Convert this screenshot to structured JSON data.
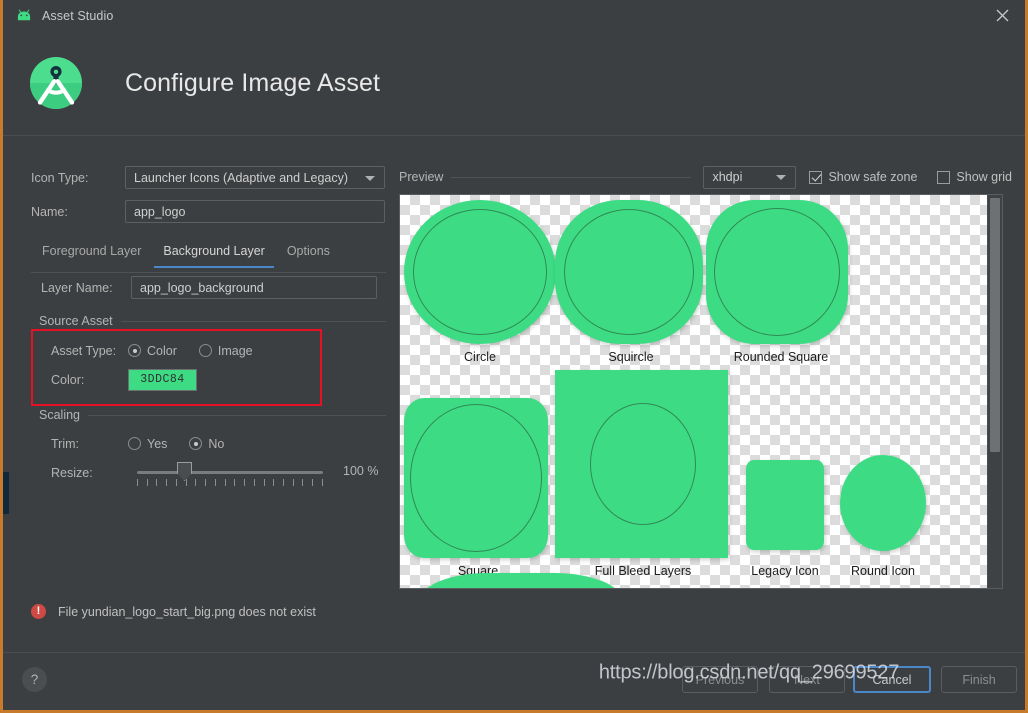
{
  "window": {
    "title": "Asset Studio",
    "app_icon": "android-studio-icon",
    "close_icon": "close-icon"
  },
  "header": {
    "title": "Configure Image Asset",
    "logo_icon": "android-studio-logo-icon"
  },
  "form": {
    "icon_type_label": "Icon Type:",
    "icon_type_value": "Launcher Icons (Adaptive and Legacy)",
    "name_label": "Name:",
    "name_value": "app_logo",
    "tabs": [
      {
        "label": "Foreground Layer",
        "active": false
      },
      {
        "label": "Background Layer",
        "active": true
      },
      {
        "label": "Options",
        "active": false
      }
    ],
    "layer_name_label": "Layer Name:",
    "layer_name_value": "app_logo_background",
    "source_asset_group": "Source Asset",
    "asset_type_label": "Asset Type:",
    "asset_type_options": [
      {
        "label": "Color",
        "selected": true
      },
      {
        "label": "Image",
        "selected": false
      }
    ],
    "color_label": "Color:",
    "color_value": "3DDC84",
    "color_hex": "#3DDC84",
    "scaling_group": "Scaling",
    "trim_label": "Trim:",
    "trim_options": [
      {
        "label": "Yes",
        "selected": false
      },
      {
        "label": "No",
        "selected": true
      }
    ],
    "resize_label": "Resize:",
    "resize_value": "100 %",
    "resize_percent": 100,
    "highlight_color": "#E81123"
  },
  "preview": {
    "label": "Preview",
    "density_value": "xhdpi",
    "show_safe_zone": {
      "label": "Show safe zone",
      "checked": true
    },
    "show_grid": {
      "label": "Show grid",
      "checked": false
    },
    "shapes": [
      {
        "caption": "Circle"
      },
      {
        "caption": "Squircle"
      },
      {
        "caption": "Rounded Square"
      },
      {
        "caption": "Square"
      },
      {
        "caption": "Full Bleed Layers"
      },
      {
        "caption": "Legacy Icon"
      },
      {
        "caption": "Round Icon"
      }
    ]
  },
  "status": {
    "error_icon": "error-exclamation-icon",
    "error_text": "File yundian_logo_start_big.png does not exist",
    "error_color": "#CF4A45"
  },
  "footer": {
    "help_label": "?",
    "previous_label": "Previous",
    "next_label": "Next",
    "cancel_label": "Cancel",
    "finish_label": "Finish"
  },
  "watermark": {
    "text": "https://blog.csdn.net/qq_29699527"
  }
}
